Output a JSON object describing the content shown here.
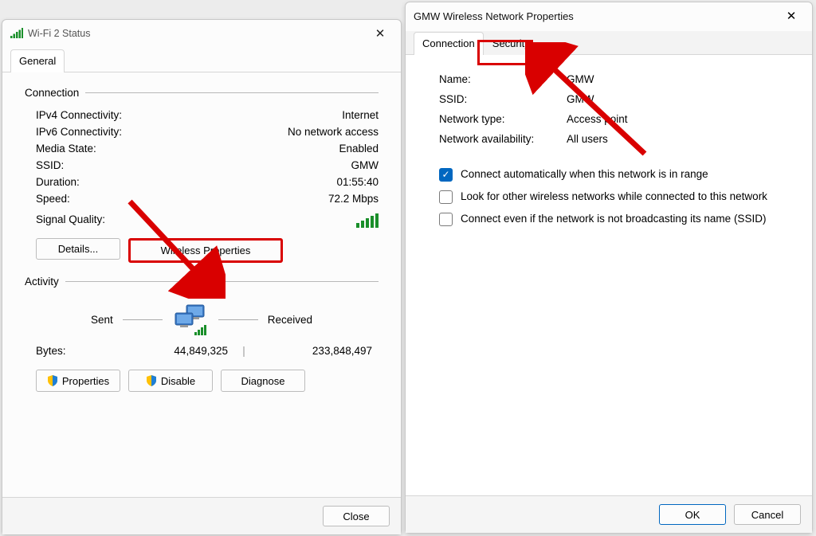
{
  "left": {
    "title": "Wi-Fi 2 Status",
    "tab_general": "General",
    "group_connection": "Connection",
    "ipv4_lbl": "IPv4 Connectivity:",
    "ipv4_val": "Internet",
    "ipv6_lbl": "IPv6 Connectivity:",
    "ipv6_val": "No network access",
    "media_lbl": "Media State:",
    "media_val": "Enabled",
    "ssid_lbl": "SSID:",
    "ssid_val": "GMW",
    "duration_lbl": "Duration:",
    "duration_val": "01:55:40",
    "speed_lbl": "Speed:",
    "speed_val": "72.2 Mbps",
    "sigq_lbl": "Signal Quality:",
    "btn_details": "Details...",
    "btn_wireless": "Wireless Properties",
    "group_activity": "Activity",
    "sent_lbl": "Sent",
    "recv_lbl": "Received",
    "bytes_lbl": "Bytes:",
    "bytes_sent": "44,849,325",
    "bytes_recv": "233,848,497",
    "btn_properties": "Properties",
    "btn_disable": "Disable",
    "btn_diagnose": "Diagnose",
    "btn_close": "Close"
  },
  "right": {
    "title": "GMW Wireless Network Properties",
    "tab_connection": "Connection",
    "tab_security": "Security",
    "name_lbl": "Name:",
    "name_val": "GMW",
    "ssid_lbl": "SSID:",
    "ssid_val": "GMW",
    "nettype_lbl": "Network type:",
    "nettype_val": "Access point",
    "avail_lbl": "Network availability:",
    "avail_val": "All users",
    "chk1": "Connect automatically when this network is in range",
    "chk2": "Look for other wireless networks while connected to this network",
    "chk3": "Connect even if the network is not broadcasting its name (SSID)",
    "btn_ok": "OK",
    "btn_cancel": "Cancel"
  }
}
